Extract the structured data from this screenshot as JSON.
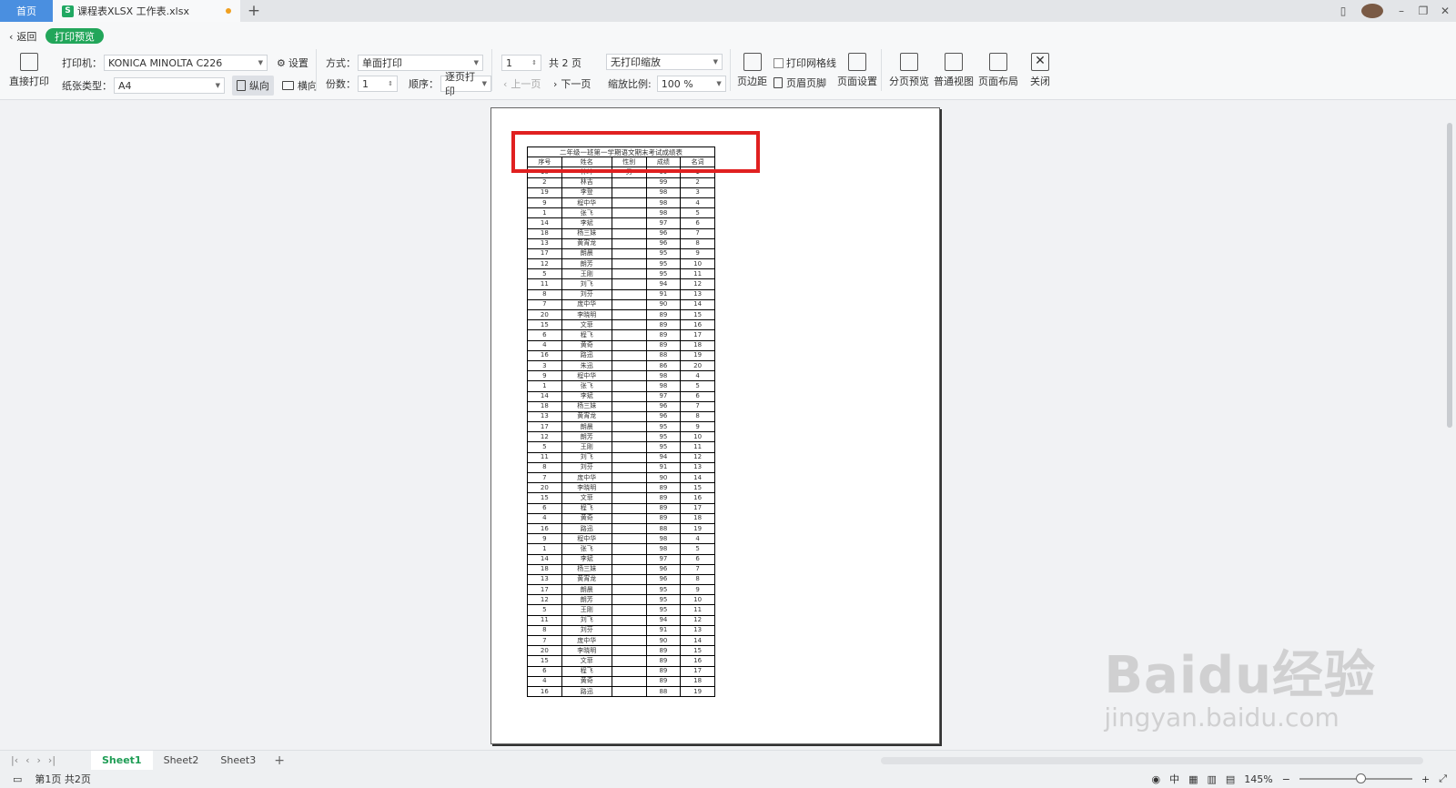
{
  "titlebar": {
    "home_tab": "首页",
    "doc_tab": "课程表XLSX 工作表.xlsx",
    "doc_logo": "S",
    "add_tab": "+"
  },
  "toolbar": {
    "back": "返回",
    "print_preview": "打印预览",
    "direct_print": "直接打印",
    "printer_label": "打印机：",
    "printer_value": "KONICA MINOLTA C226",
    "settings": "设置",
    "paper_label": "纸张类型：",
    "paper_value": "A4",
    "portrait": "纵向",
    "landscape": "横向",
    "mode_label": "方式：",
    "mode_value": "单面打印",
    "copies_label": "份数：",
    "copies_value": "1",
    "order_label": "顺序：",
    "order_value": "逐页打印",
    "page_input": "1",
    "total_pages": "共 2 页",
    "prev_page": "上一页",
    "next_page": "下一页",
    "scale_mode": "无打印缩放",
    "scale_label": "缩放比例:",
    "scale_value": "100 %",
    "margins": "页边距",
    "print_grid": "打印网格线",
    "header_footer": "页眉页脚",
    "page_setup": "页面设置",
    "page_break_preview": "分页预览",
    "normal_view": "普通视图",
    "page_layout": "页面布局",
    "close": "关闭"
  },
  "sheet": {
    "title": "二年级一班第一学期语文期末考试成绩表",
    "headers": [
      "序号",
      "姓名",
      "性别",
      "成绩",
      "名词"
    ],
    "rows": [
      [
        "10",
        "林坤",
        "男",
        "99",
        "1"
      ],
      [
        "2",
        "林吉",
        "",
        "99",
        "2"
      ],
      [
        "19",
        "李登",
        "",
        "98",
        "3"
      ],
      [
        "9",
        "程中华",
        "",
        "98",
        "4"
      ],
      [
        "1",
        "张飞",
        "",
        "98",
        "5"
      ],
      [
        "14",
        "李斌",
        "",
        "97",
        "6"
      ],
      [
        "18",
        "杨三妹",
        "",
        "96",
        "7"
      ],
      [
        "13",
        "黄宵龙",
        "",
        "96",
        "8"
      ],
      [
        "17",
        "朗晨",
        "",
        "95",
        "9"
      ],
      [
        "12",
        "朗芳",
        "",
        "95",
        "10"
      ],
      [
        "5",
        "王刚",
        "",
        "95",
        "11"
      ],
      [
        "11",
        "刘飞",
        "",
        "94",
        "12"
      ],
      [
        "8",
        "刘芬",
        "",
        "91",
        "13"
      ],
      [
        "7",
        "庞中华",
        "",
        "90",
        "14"
      ],
      [
        "20",
        "李晓明",
        "",
        "89",
        "15"
      ],
      [
        "15",
        "文菲",
        "",
        "89",
        "16"
      ],
      [
        "6",
        "程飞",
        "",
        "89",
        "17"
      ],
      [
        "4",
        "黄奇",
        "",
        "89",
        "18"
      ],
      [
        "16",
        "路迅",
        "",
        "88",
        "19"
      ],
      [
        "3",
        "朱迅",
        "",
        "86",
        "20"
      ],
      [
        "9",
        "程中华",
        "",
        "98",
        "4"
      ],
      [
        "1",
        "张飞",
        "",
        "98",
        "5"
      ],
      [
        "14",
        "李斌",
        "",
        "97",
        "6"
      ],
      [
        "18",
        "杨三妹",
        "",
        "96",
        "7"
      ],
      [
        "13",
        "黄宵龙",
        "",
        "96",
        "8"
      ],
      [
        "17",
        "朗晨",
        "",
        "95",
        "9"
      ],
      [
        "12",
        "朗芳",
        "",
        "95",
        "10"
      ],
      [
        "5",
        "王刚",
        "",
        "95",
        "11"
      ],
      [
        "11",
        "刘飞",
        "",
        "94",
        "12"
      ],
      [
        "8",
        "刘芬",
        "",
        "91",
        "13"
      ],
      [
        "7",
        "庞中华",
        "",
        "90",
        "14"
      ],
      [
        "20",
        "李晓明",
        "",
        "89",
        "15"
      ],
      [
        "15",
        "文菲",
        "",
        "89",
        "16"
      ],
      [
        "6",
        "程飞",
        "",
        "89",
        "17"
      ],
      [
        "4",
        "黄奇",
        "",
        "89",
        "18"
      ],
      [
        "16",
        "路迅",
        "",
        "88",
        "19"
      ],
      [
        "9",
        "程中华",
        "",
        "98",
        "4"
      ],
      [
        "1",
        "张飞",
        "",
        "98",
        "5"
      ],
      [
        "14",
        "李斌",
        "",
        "97",
        "6"
      ],
      [
        "18",
        "杨三妹",
        "",
        "96",
        "7"
      ],
      [
        "13",
        "黄宵龙",
        "",
        "96",
        "8"
      ],
      [
        "17",
        "朗晨",
        "",
        "95",
        "9"
      ],
      [
        "12",
        "朗芳",
        "",
        "95",
        "10"
      ],
      [
        "5",
        "王刚",
        "",
        "95",
        "11"
      ],
      [
        "11",
        "刘飞",
        "",
        "94",
        "12"
      ],
      [
        "8",
        "刘芬",
        "",
        "91",
        "13"
      ],
      [
        "7",
        "庞中华",
        "",
        "90",
        "14"
      ],
      [
        "20",
        "李晓明",
        "",
        "89",
        "15"
      ],
      [
        "15",
        "文菲",
        "",
        "89",
        "16"
      ],
      [
        "6",
        "程飞",
        "",
        "89",
        "17"
      ],
      [
        "4",
        "黄奇",
        "",
        "89",
        "18"
      ],
      [
        "16",
        "路迅",
        "",
        "88",
        "19"
      ]
    ]
  },
  "sheet_tabs": [
    "Sheet1",
    "Sheet2",
    "Sheet3"
  ],
  "sheet_add": "+",
  "status": {
    "page_info": "第1页 共2页",
    "zoom": "145%",
    "lang": "中"
  },
  "watermark": {
    "logo": "Baidu经验",
    "url": "jingyan.baidu.com"
  },
  "colors": {
    "accent": "#22a65a",
    "home_tab": "#4a8fe0",
    "highlight": "#e02020"
  }
}
